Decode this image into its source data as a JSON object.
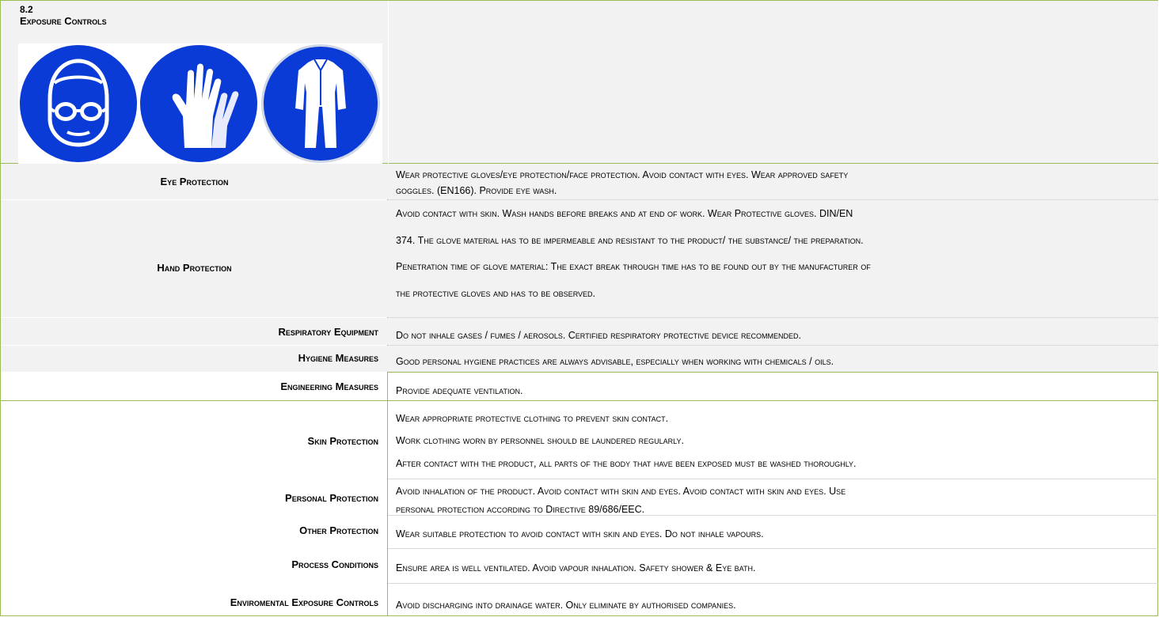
{
  "section": {
    "number": "8.2",
    "title": "Exposure Controls",
    "pictograms": [
      "face-protection-goggles-icon",
      "gloves-icon",
      "protective-clothing-icon"
    ],
    "colors": {
      "pictogram_blue": "#0a3bd6",
      "border_green": "#9bbb59",
      "shade": "#f2f2f2"
    }
  },
  "rows": {
    "eye": {
      "label": "Eye Protection",
      "lines": [
        "Wear protective gloves/eye protection/face protection.  Avoid contact with eyes. Wear approved safety",
        "goggles. (EN166). Provide eye wash."
      ]
    },
    "hand": {
      "label": "Hand Protection",
      "lines": [
        "Avoid contact with skin. Wash hands before breaks and at end of work. Wear Protective gloves. DIN/EN",
        "374.  The glove material has to be impermeable and resistant to the product/ the substance/ the preparation.",
        "Penetration time of glove material: The exact break through time has to be found out by the manufacturer of",
        "the protective gloves and has to be observed."
      ]
    },
    "respiratory": {
      "label": "Respiratory Equipment",
      "lines": [
        "Do not inhale gases / fumes / aerosols. Certified respiratory protective device recommended."
      ]
    },
    "hygiene": {
      "label": "Hygiene Measures",
      "lines": [
        "Good personal hygiene practices are always advisable, especially when working with chemicals / oils."
      ]
    },
    "engineering": {
      "label": "Engineering Measures",
      "lines": [
        "Provide adequate ventilation."
      ]
    },
    "skin": {
      "label": "Skin Protection",
      "lines": [
        "Wear appropriate protective clothing to prevent skin contact.",
        "Work clothing worn by personnel should be laundered regularly.",
        "After contact with the product, all parts of the body that have been exposed must be washed thoroughly."
      ]
    },
    "personal": {
      "label": "Personal Protection",
      "lines": [
        "Avoid inhalation of the product. Avoid contact with skin and eyes. Avoid contact with skin and eyes. Use",
        "personal protection according to Directive 89/686/EEC."
      ]
    },
    "other": {
      "label": "Other Protection",
      "lines": [
        "Wear suitable protection to avoid contact with skin and eyes. Do not inhale vapours."
      ]
    },
    "process": {
      "label": "Process Conditions",
      "lines": [
        "Ensure area is well ventilated. Avoid vapour inhalation. Safety shower & Eye bath."
      ]
    },
    "environmental": {
      "label": "Enviromental Exposure Controls",
      "lines": [
        "Avoid discharging into drainage water. Only eliminate by authorised companies."
      ]
    }
  }
}
